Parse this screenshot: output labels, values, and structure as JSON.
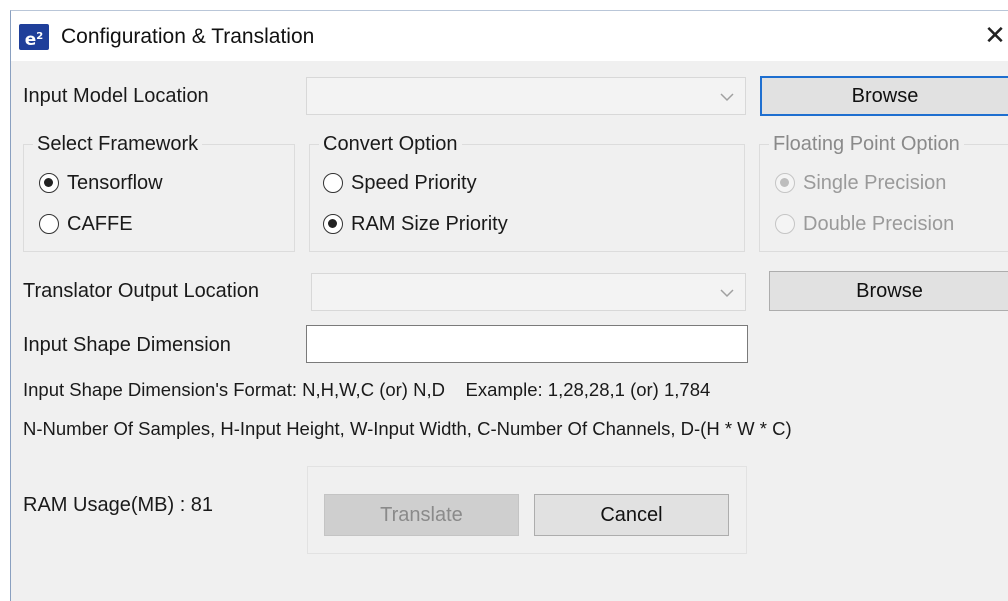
{
  "window": {
    "title": "Configuration & Translation",
    "icon_text": "e",
    "icon_sup": "2",
    "close_glyph": "✕"
  },
  "input_model": {
    "label": "Input Model Location",
    "value": "",
    "browse_label": "Browse"
  },
  "framework": {
    "title": "Select Framework",
    "options": [
      {
        "label": "Tensorflow",
        "checked": true
      },
      {
        "label": "CAFFE",
        "checked": false
      }
    ]
  },
  "convert": {
    "title": "Convert Option",
    "options": [
      {
        "label": "Speed Priority",
        "checked": false
      },
      {
        "label": "RAM Size Priority",
        "checked": true
      }
    ]
  },
  "floating_point": {
    "title": "Floating Point Option",
    "enabled": false,
    "options": [
      {
        "label": "Single Precision",
        "checked": true
      },
      {
        "label": "Double Precision",
        "checked": false
      }
    ]
  },
  "translator_output": {
    "label": "Translator Output Location",
    "value": "",
    "browse_label": "Browse"
  },
  "shape": {
    "label": "Input Shape Dimension",
    "value": "",
    "format_text": "Input Shape Dimension's Format: N,H,W,C (or) N,D    Example: 1,28,28,1 (or) 1,784",
    "legend_text": "N-Number Of Samples, H-Input Height, W-Input Width, C-Number Of Channels, D-(H * W * C)"
  },
  "footer": {
    "ram_usage": "RAM Usage(MB) : 81",
    "translate_label": "Translate",
    "cancel_label": "Cancel"
  },
  "icons": {
    "app": "e2-app-icon",
    "close": "close-icon",
    "dropdown": "chevron-down-icon"
  },
  "colors": {
    "window_bg": "#f0f0f0",
    "focus_border": "#1e6fd0",
    "app_icon_bg": "#1f3f9a"
  }
}
